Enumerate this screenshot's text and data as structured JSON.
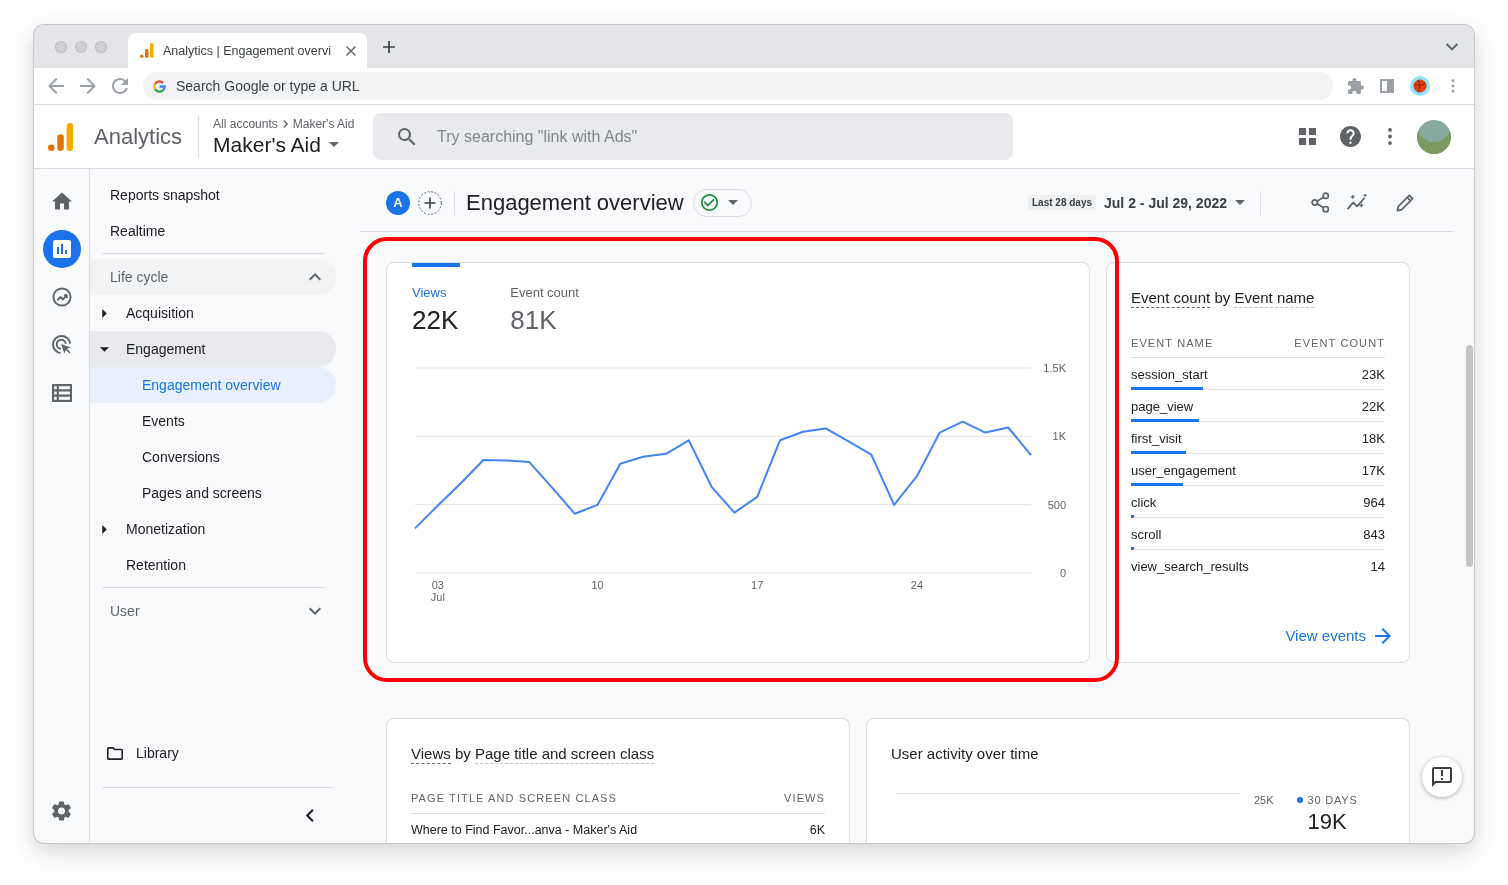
{
  "browser": {
    "tab_title": "Analytics | Engagement overvi",
    "omnibox_placeholder": "Search Google or type a URL"
  },
  "app_bar": {
    "product": "Analytics",
    "breadcrumb": [
      "All accounts",
      "Maker's Aid"
    ],
    "property": "Maker's Aid",
    "search_placeholder": "Try searching \"link with Ads\""
  },
  "rail": [
    {
      "selected": false
    },
    {
      "selected": true
    },
    {
      "selected": false
    },
    {
      "selected": false
    },
    {
      "selected": false
    }
  ],
  "nav": {
    "top_items": [
      {
        "label": "Reports snapshot",
        "selected": false
      },
      {
        "label": "Realtime",
        "selected": false
      }
    ],
    "sections": [
      {
        "label": "Life cycle",
        "expanded": true,
        "items": [
          {
            "label": "Acquisition",
            "expandable": true,
            "expanded": false
          },
          {
            "label": "Engagement",
            "expandable": true,
            "expanded": true,
            "children": [
              {
                "label": "Engagement overview",
                "selected": true
              },
              {
                "label": "Events",
                "selected": false
              },
              {
                "label": "Conversions",
                "selected": false
              },
              {
                "label": "Pages and screens",
                "selected": false
              }
            ]
          },
          {
            "label": "Monetization",
            "expandable": true,
            "expanded": false
          },
          {
            "label": "Retention",
            "expandable": false,
            "expanded": false
          }
        ]
      },
      {
        "label": "User",
        "expanded": false
      }
    ],
    "library": "Library"
  },
  "report": {
    "comparison_letter": "A",
    "title": "Engagement overview",
    "date_preset": "Last 28 days",
    "date_range": "Jul 2 - Jul 29, 2022"
  },
  "chart_card": {
    "highlighted": true,
    "metrics": [
      {
        "label": "Views",
        "value": "22K",
        "selected": true
      },
      {
        "label": "Event count",
        "value": "81K",
        "selected": false
      }
    ],
    "chart_data": {
      "type": "line",
      "x": [
        2,
        3,
        4,
        5,
        6,
        7,
        8,
        9,
        10,
        11,
        12,
        13,
        14,
        15,
        16,
        17,
        18,
        19,
        20,
        21,
        22,
        23,
        24,
        25,
        26,
        27,
        28,
        29
      ],
      "series": [
        {
          "color": "#4285f4",
          "values": [
            326,
            494,
            655,
            827,
            823,
            813,
            627,
            434,
            498,
            799,
            851,
            872,
            971,
            631,
            442,
            557,
            971,
            1034,
            1058,
            964,
            866,
            498,
            708,
            1027,
            1107,
            1027,
            1065,
            862
          ]
        }
      ],
      "xlim": [
        2,
        29
      ],
      "ylim": [
        0,
        1500
      ],
      "xticks": [
        {
          "value": 3,
          "label": "03 Jul"
        },
        {
          "value": 10,
          "label": "10"
        },
        {
          "value": 17,
          "label": "17"
        },
        {
          "value": 24,
          "label": "24"
        }
      ],
      "yticks": [
        0,
        500,
        {
          "value": 1000,
          "label": "1K"
        },
        {
          "value": 1500,
          "label": "1.5K"
        }
      ]
    }
  },
  "events_card": {
    "title": {
      "metric": "Event count",
      "joiner": "by",
      "dimension": "Event name"
    },
    "columns": [
      "EVENT NAME",
      "EVENT COUNT"
    ],
    "rows": [
      {
        "name": "session_start",
        "count": "23K",
        "level": 0.285
      },
      {
        "name": "page_view",
        "count": "22K",
        "level": 0.268
      },
      {
        "name": "first_visit",
        "count": "18K",
        "level": 0.218
      },
      {
        "name": "user_engagement",
        "count": "17K",
        "level": 0.206
      },
      {
        "name": "click",
        "count": "964",
        "level": 0.012
      },
      {
        "name": "scroll",
        "count": "843",
        "level": 0.01
      },
      {
        "name": "view_search_results",
        "count": "14"
      }
    ],
    "link": "View events"
  },
  "pages_card": {
    "title": {
      "metric": "Views",
      "joiner": "by",
      "dimension": "Page title and screen class"
    },
    "columns": [
      "PAGE TITLE AND SCREEN CLASS",
      "VIEWS"
    ],
    "rows": [
      {
        "title": "Where to Find Favor...anva - Maker's Aid",
        "views": "6K"
      }
    ]
  },
  "activity_card": {
    "title": "User activity over time",
    "top_tick": "25K",
    "legend": [
      {
        "label": "30 DAYS",
        "value": "19K"
      }
    ]
  }
}
